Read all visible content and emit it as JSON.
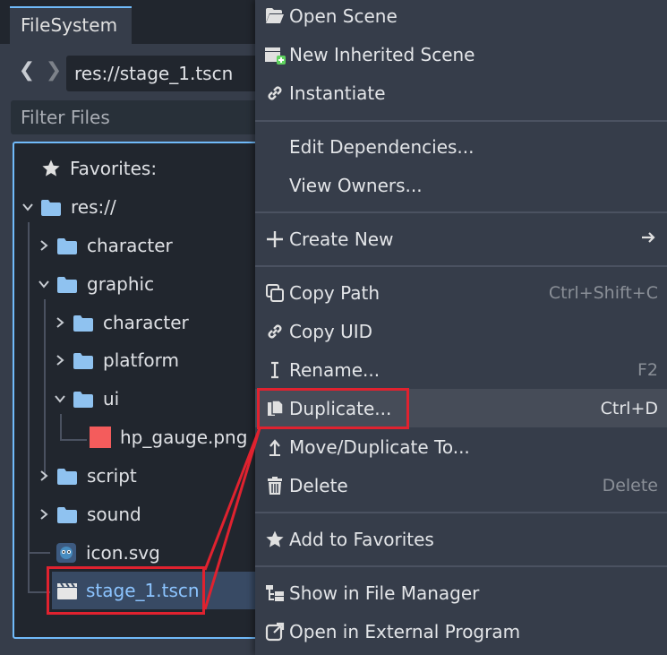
{
  "filesystem": {
    "tab_label": "FileSystem",
    "path": "res://stage_1.tscn",
    "filter_placeholder": "Filter Files",
    "favorites_label": "Favorites:",
    "tree": [
      {
        "label": "res://",
        "type": "folder",
        "expanded": true
      },
      {
        "label": "character",
        "type": "folder",
        "expanded": false
      },
      {
        "label": "graphic",
        "type": "folder",
        "expanded": true
      },
      {
        "label": "character",
        "type": "folder",
        "expanded": false
      },
      {
        "label": "platform",
        "type": "folder",
        "expanded": false
      },
      {
        "label": "ui",
        "type": "folder",
        "expanded": true
      },
      {
        "label": "hp_gauge.png",
        "type": "image"
      },
      {
        "label": "script",
        "type": "folder",
        "expanded": false
      },
      {
        "label": "sound",
        "type": "folder",
        "expanded": false
      },
      {
        "label": "icon.svg",
        "type": "svg"
      },
      {
        "label": "stage_1.tscn",
        "type": "scene",
        "selected": true
      }
    ]
  },
  "context_menu": {
    "items": [
      {
        "label": "Open Scene",
        "icon": "folder-open-icon"
      },
      {
        "label": "New Inherited Scene",
        "icon": "clapper-plus-icon"
      },
      {
        "label": "Instantiate",
        "icon": "link-icon"
      },
      {
        "label": "Edit Dependencies...",
        "icon": ""
      },
      {
        "label": "View Owners...",
        "icon": ""
      },
      {
        "label": "Create New",
        "icon": "plus-icon",
        "submenu": true
      },
      {
        "label": "Copy Path",
        "icon": "copy-icon",
        "shortcut": "Ctrl+Shift+C"
      },
      {
        "label": "Copy UID",
        "icon": "link-icon"
      },
      {
        "label": "Rename...",
        "icon": "rename-icon",
        "shortcut": "F2"
      },
      {
        "label": "Duplicate...",
        "icon": "duplicate-icon",
        "shortcut": "Ctrl+D",
        "hovered": true
      },
      {
        "label": "Move/Duplicate To...",
        "icon": "move-icon"
      },
      {
        "label": "Delete",
        "icon": "trash-icon",
        "shortcut": "Delete"
      },
      {
        "label": "Add to Favorites",
        "icon": "star-icon"
      },
      {
        "label": "Show in File Manager",
        "icon": "filesystem-icon"
      },
      {
        "label": "Open in External Program",
        "icon": "external-link-icon"
      }
    ]
  },
  "colors": {
    "accent": "#70bafa",
    "annotation": "#e0222f",
    "folder": "#8fc2f0",
    "selected_text": "#8cc4ff"
  }
}
